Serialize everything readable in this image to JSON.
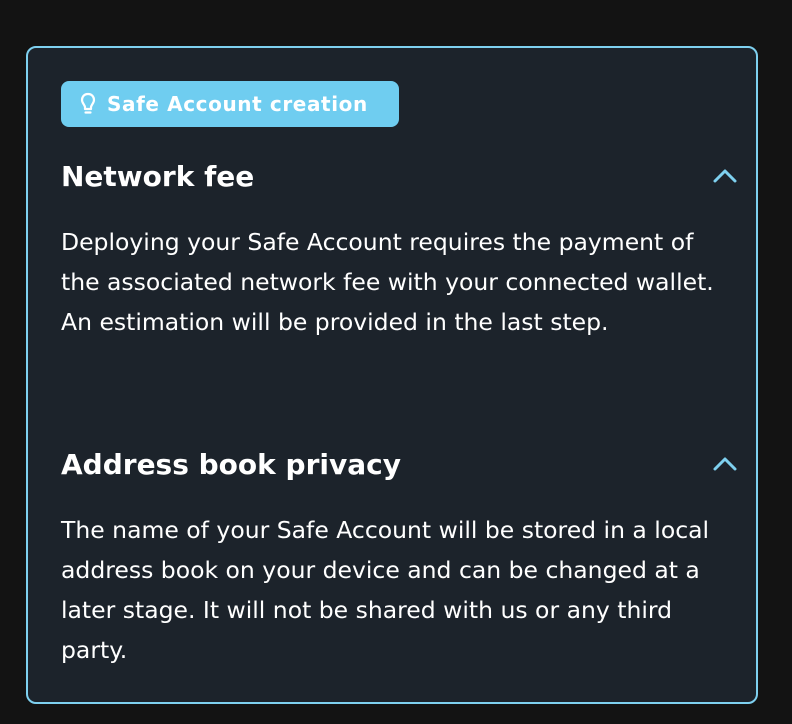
{
  "badge": {
    "icon": "lightbulb-icon",
    "label": "Safe Account creation"
  },
  "sections": [
    {
      "title": "Network fee",
      "expanded": true,
      "toggle_icon": "chevron-up-icon",
      "body": "Deploying your Safe Account requires the payment of the associated network fee with your connected wallet. An estimation will be provided in the last step."
    },
    {
      "title": "Address book privacy",
      "expanded": true,
      "toggle_icon": "chevron-up-icon",
      "body": "The name of your Safe Account will be stored in a local address book on your device and can be changed at a later stage. It will not be shared with us or any third party."
    }
  ],
  "colors": {
    "page_background": "#131313",
    "card_background": "#1c232b",
    "card_border": "#7ed0ef",
    "badge_background": "#6fcdf0",
    "accent": "#7ed0ef",
    "text": "#ffffff"
  }
}
